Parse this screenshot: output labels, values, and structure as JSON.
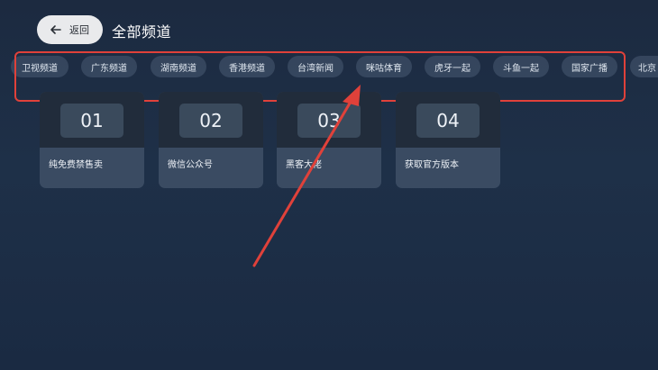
{
  "header": {
    "back_label": "返回",
    "title": "全部频道"
  },
  "tabs": [
    {
      "label": "卫视频道"
    },
    {
      "label": "广东频道"
    },
    {
      "label": "湖南频道"
    },
    {
      "label": "香港频道"
    },
    {
      "label": "台湾新闻"
    },
    {
      "label": "咪咕体育"
    },
    {
      "label": "虎牙一起"
    },
    {
      "label": "斗鱼一起"
    },
    {
      "label": "国家广播"
    },
    {
      "label": "北京"
    }
  ],
  "cards": [
    {
      "number": "01",
      "name": "纯免费禁售卖"
    },
    {
      "number": "02",
      "name": "微信公众号"
    },
    {
      "number": "03",
      "name": "黑客大佬"
    },
    {
      "number": "04",
      "name": "获取官方版本"
    }
  ],
  "colors": {
    "annotation": "#e0413a",
    "background": "#1e3048"
  }
}
